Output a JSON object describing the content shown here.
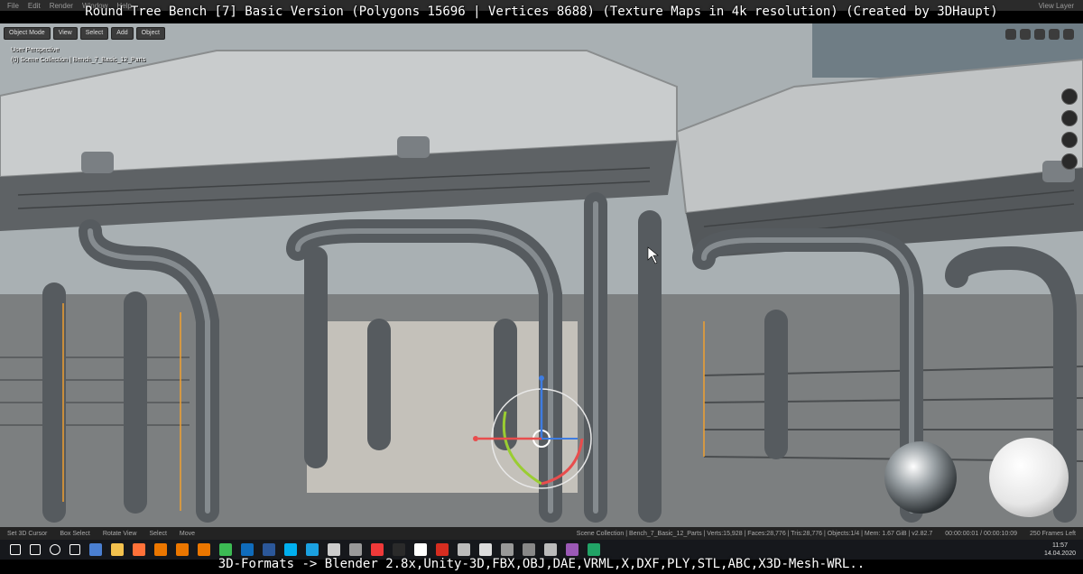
{
  "title_overlay": "Round Tree Bench [7] Basic Version (Polygons 15696 | Vertices 8688) (Texture Maps in 4k resolution) (Created by 3DHaupt)",
  "menubar": {
    "items": [
      "File",
      "Edit",
      "Render",
      "Window",
      "Help"
    ],
    "right_label": "View Layer"
  },
  "viewport": {
    "header_buttons": [
      "Object Mode",
      "View",
      "Select",
      "Add",
      "Object"
    ],
    "perspective_label": "User Perspective",
    "collection_label": "(0) Scene Collection | Bench_7_Basic_12_Parts"
  },
  "statusbar": {
    "items": [
      "Set 3D Cursor",
      "Box Select",
      "Rotate View",
      "Select",
      "Move"
    ],
    "stats": "Scene Collection | Bench_7_Basic_12_Parts | Verts:15,928 | Faces:28,776 | Tris:28,776 | Objects:1/4 | Mem: 1.67 GiB | v2.82.7",
    "timecode": "00:00:00:01 / 00:00:10:09",
    "frames_left": "250 Frames Left"
  },
  "taskbar": {
    "icons": [
      "windows-start",
      "search",
      "cortana",
      "task-view",
      "save",
      "file-explorer",
      "firefox",
      "blender",
      "blender-2",
      "blender-3",
      "notepad",
      "outlook",
      "word",
      "skype",
      "edge",
      "3d-viewer",
      "app",
      "vivaldi",
      "inkscape",
      "unity",
      "acrobat",
      "paint",
      "unity-hub",
      "app-2",
      "app-3",
      "calculator",
      "app-4",
      "excel"
    ],
    "icon_colors": [
      "#ffffff",
      "#ffffff",
      "#ffffff",
      "#ffffff",
      "#4a7fd1",
      "#f2c14e",
      "#ff7139",
      "#ea7600",
      "#ea7600",
      "#ea7600",
      "#3cba54",
      "#0f6cbd",
      "#2b579a",
      "#00aff0",
      "#1ba1e2",
      "#cccccc",
      "#999999",
      "#ef3939",
      "#2a2a2a",
      "#ffffff",
      "#d62d20",
      "#bbbbbb",
      "#dddddd",
      "#999999",
      "#888888",
      "#bbbbbb",
      "#9b59b6",
      "#21a366"
    ],
    "time": "11:57",
    "date": "14.04.2020"
  },
  "subtitle": "3D-Formats -> Blender 2.8x,Unity-3D,FBX,OBJ,DAE,VRML,X,DXF,PLY,STL,ABC,X3D-Mesh-WRL.."
}
